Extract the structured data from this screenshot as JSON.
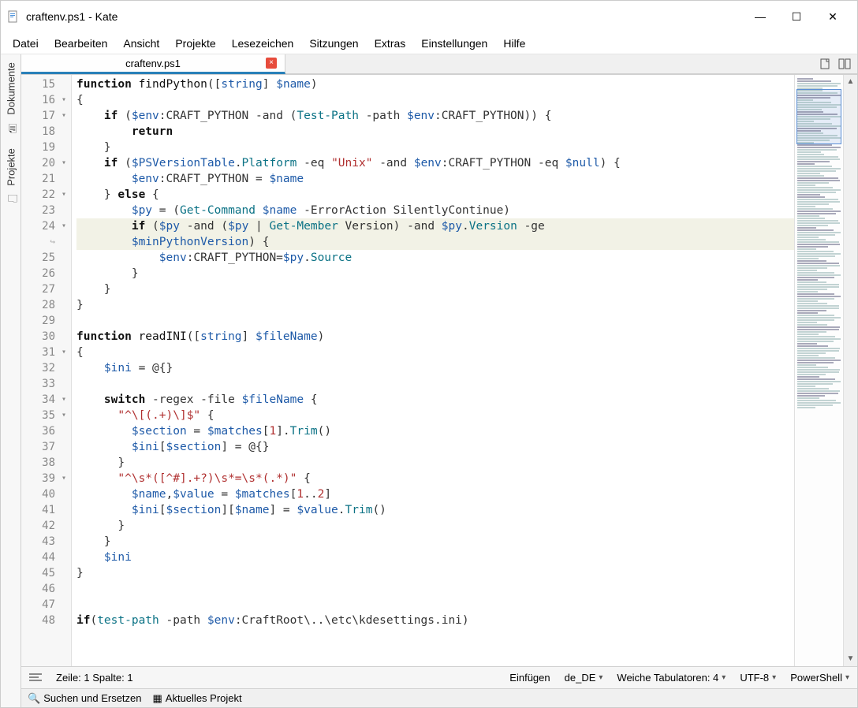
{
  "window": {
    "title": "craftenv.ps1 - Kate"
  },
  "menubar": [
    "Datei",
    "Bearbeiten",
    "Ansicht",
    "Projekte",
    "Lesezeichen",
    "Sitzungen",
    "Extras",
    "Einstellungen",
    "Hilfe"
  ],
  "sidebar": {
    "items": [
      {
        "icon": "document-icon",
        "label": "Dokumente"
      },
      {
        "icon": "project-icon",
        "label": "Projekte"
      }
    ]
  },
  "tabs": [
    {
      "label": "craftenv.ps1",
      "active": true
    }
  ],
  "gutter_start": 15,
  "lines": [
    {
      "n": 15,
      "fold": "",
      "html": "<span class='kw'>function</span> <span class='fn'>findPython</span>([<span class='type-blue'>string</span>] <span class='var'>$name</span>)"
    },
    {
      "n": 16,
      "fold": "▾",
      "html": "{"
    },
    {
      "n": 17,
      "fold": "▾",
      "html": "    <span class='kw'>if</span> (<span class='var'>$env</span>:CRAFT_PYTHON <span class='op'>-and</span> (<span class='ty'>Test-Path</span> <span class='op'>-path</span> <span class='var'>$env</span>:CRAFT_PYTHON)) {"
    },
    {
      "n": 18,
      "fold": "",
      "html": "        <span class='kw'>return</span>"
    },
    {
      "n": 19,
      "fold": "",
      "html": "    }"
    },
    {
      "n": 20,
      "fold": "▾",
      "html": "    <span class='kw'>if</span> (<span class='var'>$PSVersionTable</span>.<span class='prop'>Platform</span> <span class='op'>-eq</span> <span class='str'>\"Unix\"</span> <span class='op'>-and</span> <span class='var'>$env</span>:CRAFT_PYTHON <span class='op'>-eq</span> <span class='var'>$null</span>) {"
    },
    {
      "n": 21,
      "fold": "",
      "html": "        <span class='var'>$env</span>:CRAFT_PYTHON = <span class='var'>$name</span>"
    },
    {
      "n": 22,
      "fold": "▾",
      "html": "    } <span class='kw'>else</span> {"
    },
    {
      "n": 23,
      "fold": "",
      "html": "        <span class='var'>$py</span> = (<span class='ty'>Get-Command</span> <span class='var'>$name</span> <span class='op'>-ErrorAction</span> SilentlyContinue)"
    },
    {
      "n": 24,
      "fold": "▾",
      "hl": true,
      "html": "        <span class='kw'>if</span> (<span class='var'>$py</span> <span class='op'>-and</span> (<span class='var'>$py</span> | <span class='ty'>Get-Member</span> Version) <span class='op'>-and</span> <span class='var'>$py</span>.<span class='prop'>Version</span> <span class='op'>-ge</span> "
    },
    {
      "n": "↪",
      "fold": "",
      "hl": true,
      "wrap": true,
      "html": "        <span class='var'>$minPythonVersion</span>) {"
    },
    {
      "n": 25,
      "fold": "",
      "html": "            <span class='var'>$env</span>:CRAFT_PYTHON=<span class='var'>$py</span>.<span class='prop'>Source</span>"
    },
    {
      "n": 26,
      "fold": "",
      "html": "        }"
    },
    {
      "n": 27,
      "fold": "",
      "html": "    }"
    },
    {
      "n": 28,
      "fold": "",
      "html": "}"
    },
    {
      "n": 29,
      "fold": "",
      "html": ""
    },
    {
      "n": 30,
      "fold": "",
      "html": "<span class='kw'>function</span> <span class='fn'>readINI</span>([<span class='type-blue'>string</span>] <span class='var'>$fileName</span>)"
    },
    {
      "n": 31,
      "fold": "▾",
      "html": "{"
    },
    {
      "n": 32,
      "fold": "",
      "html": "    <span class='var'>$ini</span> = @{}"
    },
    {
      "n": 33,
      "fold": "",
      "html": ""
    },
    {
      "n": 34,
      "fold": "▾",
      "html": "    <span class='kw'>switch</span> <span class='op'>-regex</span> <span class='op'>-file</span> <span class='var'>$fileName</span> {"
    },
    {
      "n": 35,
      "fold": "▾",
      "html": "      <span class='str'>\"^\\[(.+)\\]$\"</span> {"
    },
    {
      "n": 36,
      "fold": "",
      "html": "        <span class='var'>$section</span> = <span class='var'>$matches</span>[<span class='num'>1</span>].<span class='prop'>Trim</span>()"
    },
    {
      "n": 37,
      "fold": "",
      "html": "        <span class='var'>$ini</span>[<span class='var'>$section</span>] = @{}"
    },
    {
      "n": 38,
      "fold": "",
      "html": "      }"
    },
    {
      "n": 39,
      "fold": "▾",
      "html": "      <span class='str'>\"^\\s*([^#].+?)\\s*=\\s*(.*)\"</span> {"
    },
    {
      "n": 40,
      "fold": "",
      "html": "        <span class='var'>$name</span>,<span class='var'>$value</span> = <span class='var'>$matches</span>[<span class='num'>1</span>..<span class='num'>2</span>]"
    },
    {
      "n": 41,
      "fold": "",
      "html": "        <span class='var'>$ini</span>[<span class='var'>$section</span>][<span class='var'>$name</span>] = <span class='var'>$value</span>.<span class='prop'>Trim</span>()"
    },
    {
      "n": 42,
      "fold": "",
      "html": "      }"
    },
    {
      "n": 43,
      "fold": "",
      "html": "    }"
    },
    {
      "n": 44,
      "fold": "",
      "html": "    <span class='var'>$ini</span>"
    },
    {
      "n": 45,
      "fold": "",
      "html": "}"
    },
    {
      "n": 46,
      "fold": "",
      "html": ""
    },
    {
      "n": 47,
      "fold": "",
      "html": ""
    },
    {
      "n": 48,
      "fold": "",
      "html": "<span class='kw'>if</span>(<span class='ty'>test-path</span> <span class='op'>-path</span> <span class='var'>$env</span>:CraftRoot\\..\\etc\\kdesettings.ini)"
    }
  ],
  "statusbar": {
    "cursor": "Zeile: 1 Spalte: 1",
    "mode": "Einfügen",
    "locale": "de_DE",
    "tabs": "Weiche Tabulatoren: 4",
    "encoding": "UTF-8",
    "lang": "PowerShell"
  },
  "bottombar": {
    "search": "Suchen und Ersetzen",
    "project": "Aktuelles Projekt"
  }
}
